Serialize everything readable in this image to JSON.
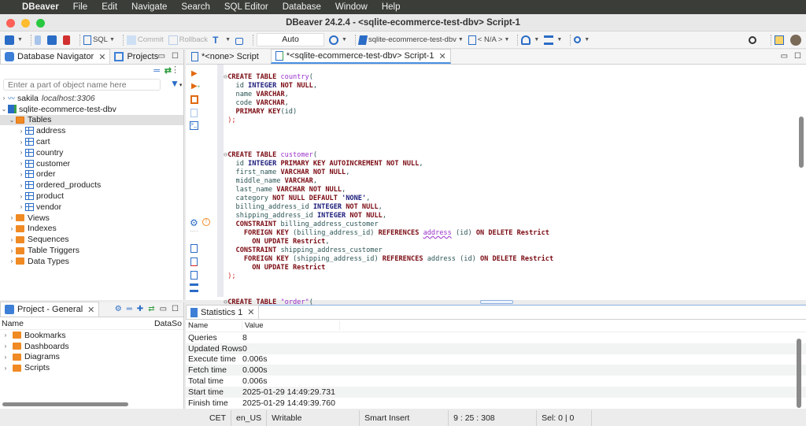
{
  "menubar": {
    "app": "DBeaver",
    "items": [
      "File",
      "Edit",
      "Navigate",
      "Search",
      "SQL Editor",
      "Database",
      "Window",
      "Help"
    ]
  },
  "window": {
    "title": "DBeaver 24.2.4 - <sqlite-ecommerce-test-dbv> Script-1"
  },
  "toolbar": {
    "sql_label": "SQL",
    "commit_label": "Commit",
    "rollback_label": "Rollback",
    "transaction_mode": "Auto",
    "datasource": "sqlite-ecommerce-test-dbv",
    "schema": "< N/A >"
  },
  "navigator": {
    "tabs": [
      {
        "label": "Database Navigator"
      },
      {
        "label": "Projects"
      }
    ],
    "search_placeholder": "Enter a part of object name here",
    "connections": [
      {
        "name": "sakila",
        "host": "localhost:3306"
      },
      {
        "name": "sqlite-ecommerce-test-dbv"
      }
    ],
    "tables_label": "Tables",
    "tables": [
      "address",
      "cart",
      "country",
      "customer",
      "order",
      "ordered_products",
      "product",
      "vendor"
    ],
    "folders": [
      "Views",
      "Indexes",
      "Sequences",
      "Table Triggers",
      "Data Types"
    ]
  },
  "project": {
    "tab": "Project - General",
    "columns": [
      "Name",
      "DataSo"
    ],
    "items": [
      "Bookmarks",
      "Dashboards",
      "Diagrams",
      "Scripts"
    ]
  },
  "editor": {
    "tabs": [
      {
        "label": "*<none> Script"
      },
      {
        "label": "*<sqlite-ecommerce-test-dbv> Script-1"
      }
    ]
  },
  "results": {
    "tab": "Statistics 1",
    "columns": [
      "Name",
      "Value"
    ],
    "rows": [
      {
        "name": "Queries",
        "value": "8"
      },
      {
        "name": "Updated Rows",
        "value": "0"
      },
      {
        "name": "Execute time",
        "value": "0.006s"
      },
      {
        "name": "Fetch time",
        "value": "0.000s"
      },
      {
        "name": "Total time",
        "value": "0.006s"
      },
      {
        "name": "Start time",
        "value": "2025-01-29 14:49:29.731"
      },
      {
        "name": "Finish time",
        "value": "2025-01-29 14:49:39.760"
      }
    ]
  },
  "statusbar": {
    "timezone": "CET",
    "locale": "en_US",
    "mode": "Writable",
    "insert": "Smart Insert",
    "position": "9 : 25 : 308",
    "selection": "Sel: 0 | 0"
  }
}
